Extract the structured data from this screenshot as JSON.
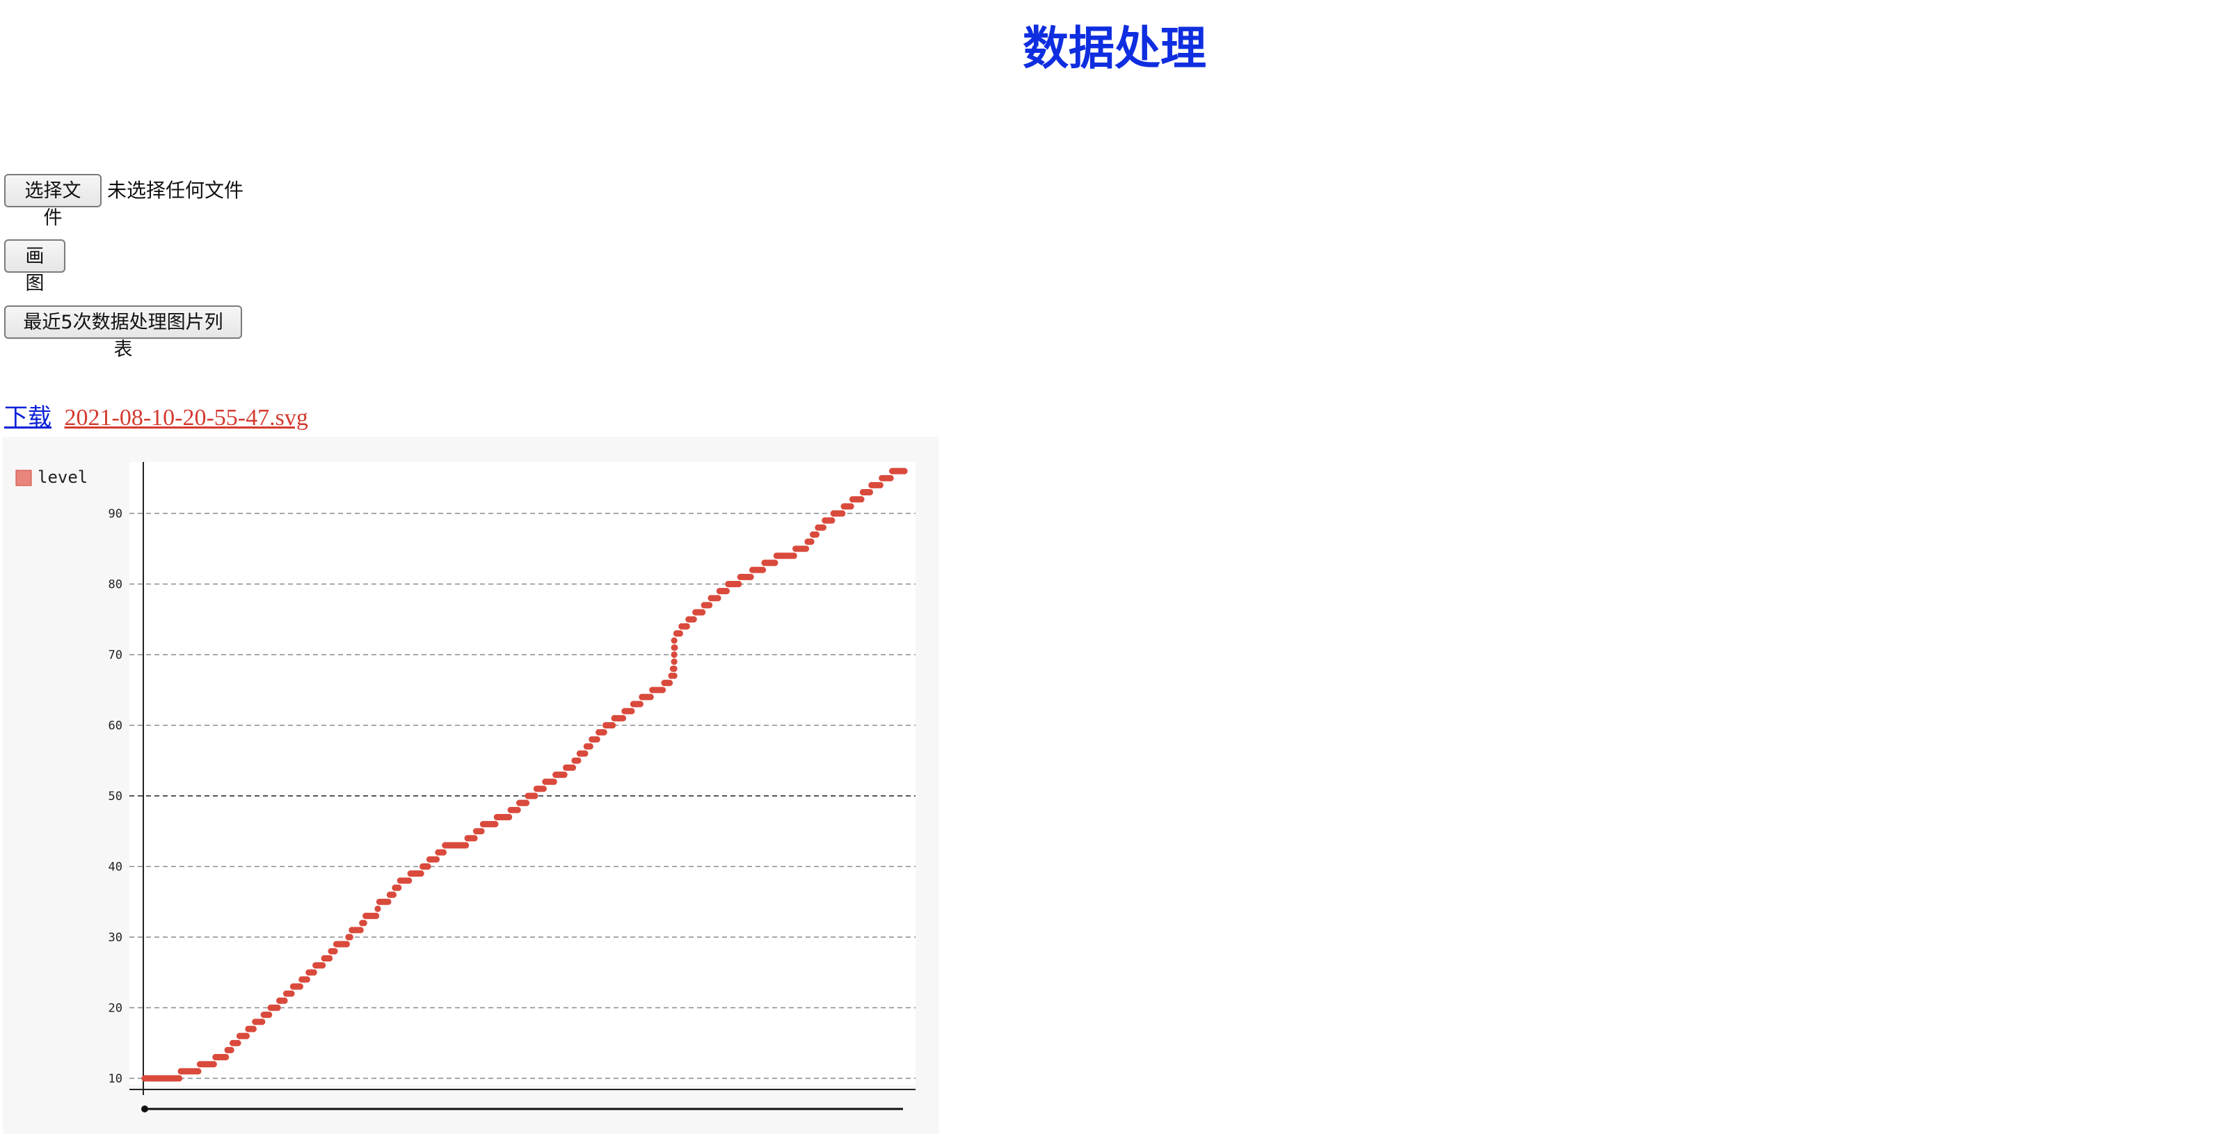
{
  "page": {
    "title": "数据处理"
  },
  "controls": {
    "choose_file_label": "选择文件",
    "file_status": "未选择任何文件",
    "draw_label": "画图",
    "recent_list_label": "最近5次数据处理图片列表"
  },
  "download": {
    "link_label": "下载",
    "file_name": "2021-08-10-20-55-47.svg"
  },
  "colors": {
    "title": "#0f2ee0",
    "series": "#d94a3c",
    "link": "#0c22d6",
    "file_link": "#d43a2f"
  },
  "chart_data": {
    "type": "scatter",
    "title": "",
    "xlabel": "",
    "ylabel": "",
    "legend": {
      "entries": [
        "level"
      ],
      "placement": "top-left"
    },
    "ylim": [
      7,
      99
    ],
    "y_ticks": [
      10,
      20,
      30,
      40,
      50,
      60,
      70,
      80,
      90
    ],
    "grid": true,
    "series": [
      {
        "name": "level",
        "breakpoints": [
          [
            0.0,
            10
          ],
          [
            0.045,
            10
          ],
          [
            0.05,
            11
          ],
          [
            0.07,
            11
          ],
          [
            0.075,
            12
          ],
          [
            0.09,
            12
          ],
          [
            0.095,
            13
          ],
          [
            0.105,
            13
          ],
          [
            0.11,
            14
          ],
          [
            0.17,
            20
          ],
          [
            0.24,
            27
          ],
          [
            0.255,
            29
          ],
          [
            0.265,
            29
          ],
          [
            0.275,
            31
          ],
          [
            0.285,
            31
          ],
          [
            0.29,
            33
          ],
          [
            0.305,
            33
          ],
          [
            0.31,
            35
          ],
          [
            0.32,
            35
          ],
          [
            0.33,
            37
          ],
          [
            0.34,
            38
          ],
          [
            0.36,
            39
          ],
          [
            0.4,
            43
          ],
          [
            0.42,
            43
          ],
          [
            0.45,
            46
          ],
          [
            0.475,
            47
          ],
          [
            0.52,
            51
          ],
          [
            0.56,
            54
          ],
          [
            0.6,
            59
          ],
          [
            0.66,
            64
          ],
          [
            0.69,
            66
          ],
          [
            0.695,
            68
          ],
          [
            0.7,
            73
          ],
          [
            0.76,
            79
          ],
          [
            0.79,
            81
          ],
          [
            0.84,
            84
          ],
          [
            0.87,
            85
          ],
          [
            0.88,
            87
          ],
          [
            0.9,
            89
          ],
          [
            0.95,
            93
          ],
          [
            0.99,
            96
          ],
          [
            1.0,
            96
          ]
        ]
      }
    ]
  }
}
